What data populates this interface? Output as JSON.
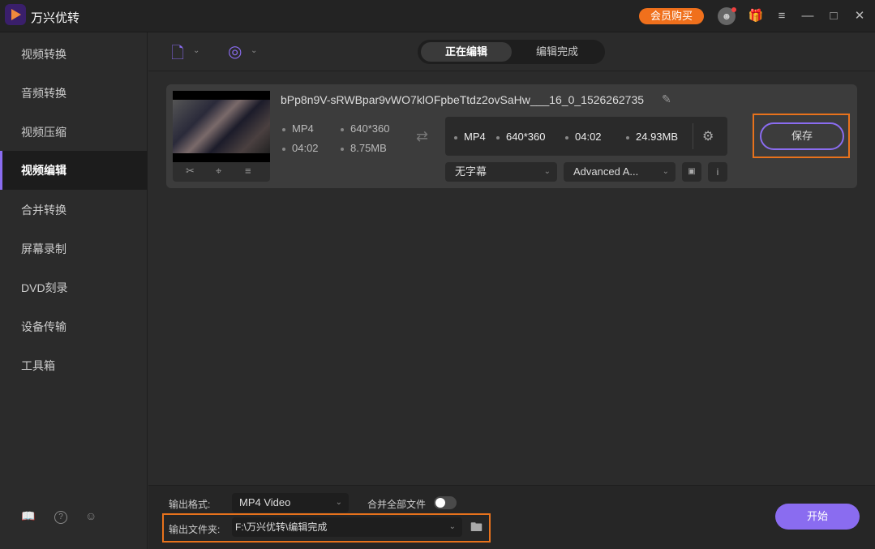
{
  "app": {
    "title": "万兴优转",
    "vip_label": "会员购买",
    "accent": "#8a6cf0",
    "highlight": "#e8721c"
  },
  "titlebar": {
    "icons": [
      "avatar-icon",
      "gift-icon",
      "menu-icon",
      "minimize-icon",
      "maximize-icon",
      "close-icon"
    ]
  },
  "sidebar": {
    "items": [
      {
        "label": "视频转换"
      },
      {
        "label": "音频转换"
      },
      {
        "label": "视频压缩"
      },
      {
        "label": "视频编辑",
        "active": true
      },
      {
        "label": "合并转换"
      },
      {
        "label": "屏幕录制"
      },
      {
        "label": "DVD刻录"
      },
      {
        "label": "设备传输"
      },
      {
        "label": "工具箱"
      }
    ],
    "footer_icons": [
      "book-icon",
      "help-icon",
      "user-icon"
    ]
  },
  "tabs": [
    {
      "label": "正在编辑",
      "active": true
    },
    {
      "label": "编辑完成"
    }
  ],
  "file": {
    "name": "bPp8n9V-sRWBpar9vWO7klOFpbeTtdz2ovSaHw___16_0_1526262735",
    "source": {
      "format": "MP4",
      "resolution": "640*360",
      "duration": "04:02",
      "size": "8.75MB"
    },
    "output": {
      "format": "MP4",
      "resolution": "640*360",
      "duration": "04:02",
      "size": "24.93MB"
    },
    "subtitle": "无字幕",
    "audio": "Advanced A...",
    "save_label": "保存"
  },
  "bottom": {
    "format_label": "输出格式:",
    "format_value": "MP4 Video",
    "merge_label": "合并全部文件",
    "merge_on": false,
    "folder_label": "输出文件夹:",
    "folder_value": "F:\\万兴优转\\编辑完成",
    "start_label": "开始"
  }
}
